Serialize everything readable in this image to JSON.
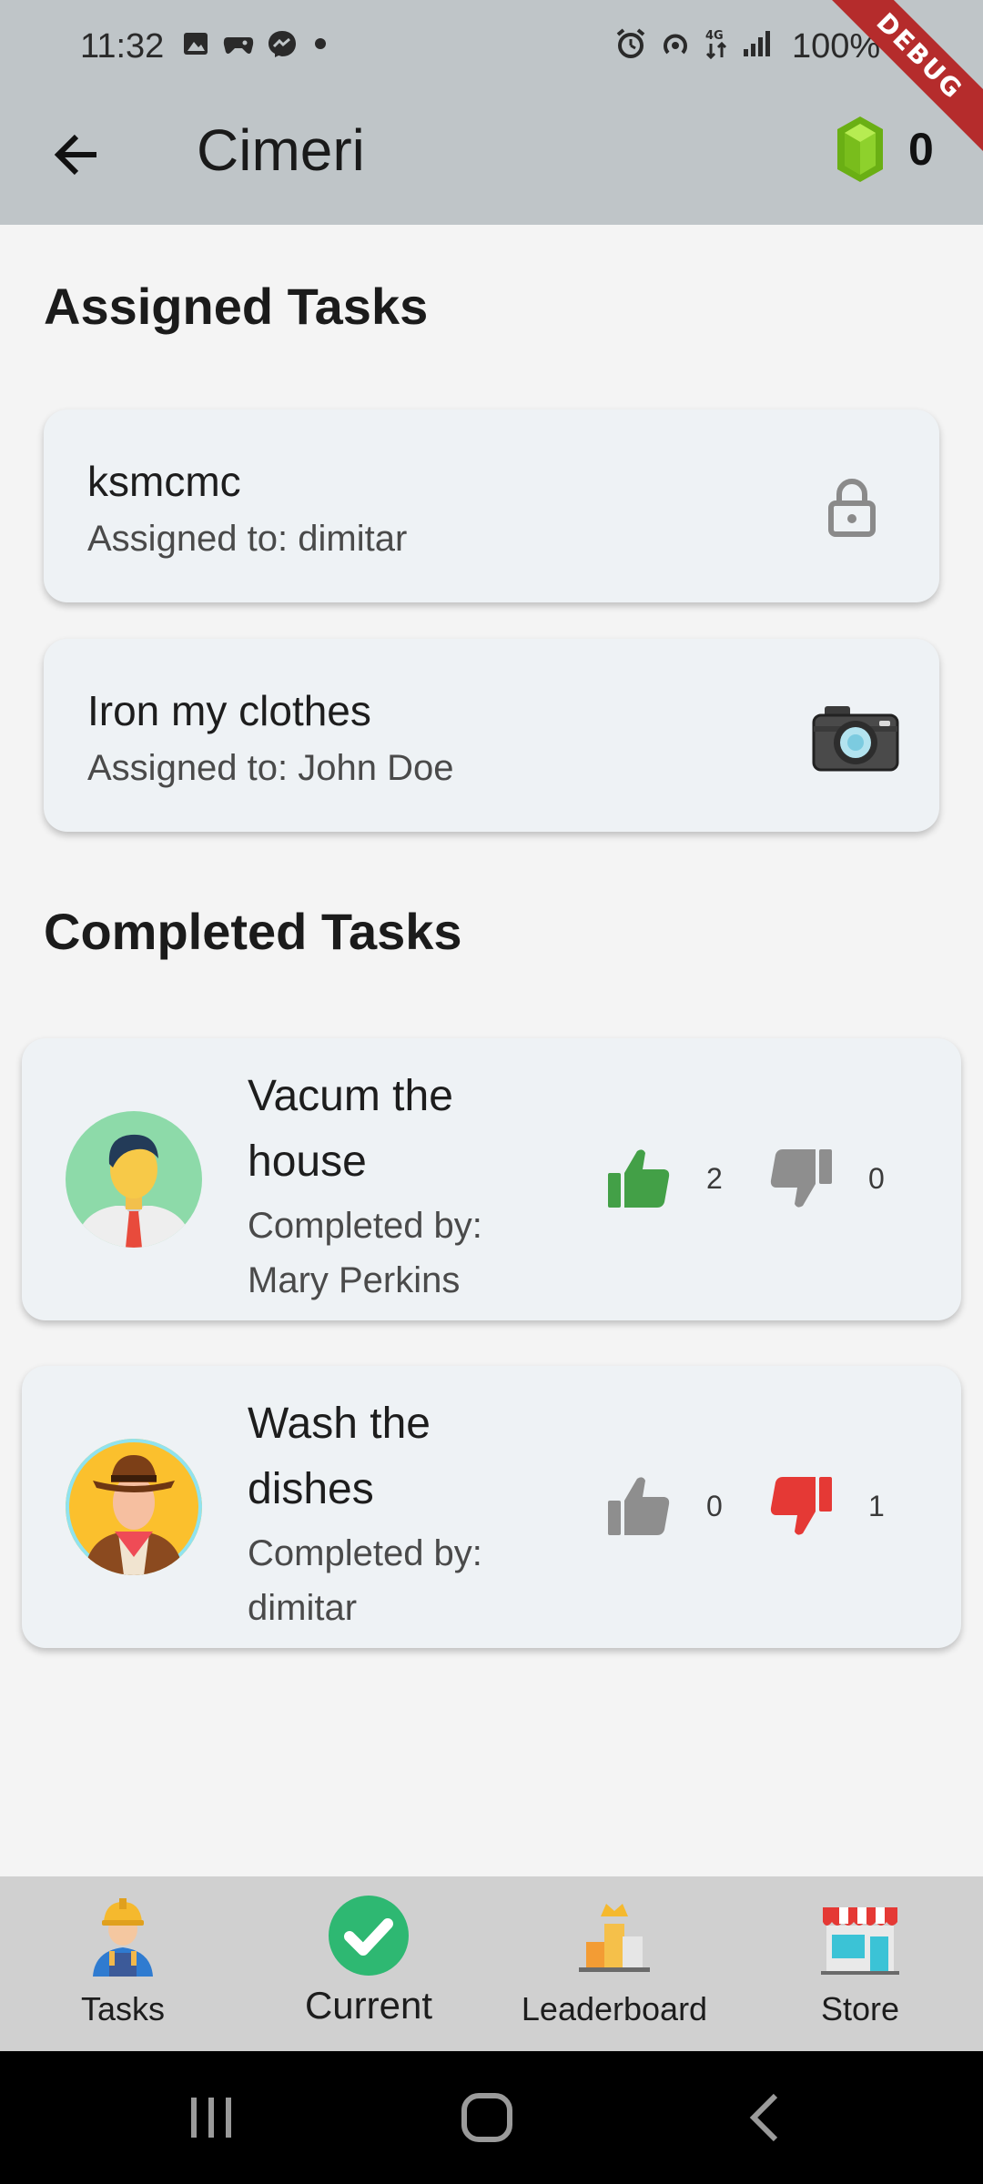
{
  "status_bar": {
    "time": "11:32",
    "battery": "100%",
    "debug_banner": "DEBUG",
    "left_icons": [
      "image-icon",
      "game-icon",
      "messenger-icon",
      "dot-icon"
    ],
    "right_icons": [
      "alarm-icon",
      "hotspot-icon",
      "data-4g-icon",
      "signal-icon"
    ]
  },
  "app_bar": {
    "title": "Cimeri",
    "gem_count": "0"
  },
  "assigned": {
    "title": "Assigned Tasks",
    "tasks": [
      {
        "name": "ksmcmc",
        "assignee": "Assigned to: dimitar",
        "icon": "lock-icon"
      },
      {
        "name": "Iron my clothes",
        "assignee": "Assigned to: John Doe",
        "icon": "camera-icon"
      }
    ]
  },
  "completed": {
    "title": "Completed Tasks",
    "tasks": [
      {
        "title": "Vacum the house",
        "completed_by": "Completed by: Mary Perkins",
        "likes": "2",
        "dislikes": "0",
        "liked": true,
        "disliked": false,
        "avatar": "businessman-avatar"
      },
      {
        "title": "Wash the dishes",
        "completed_by": "Completed by: dimitar",
        "likes": "0",
        "dislikes": "1",
        "liked": false,
        "disliked": true,
        "avatar": "cowboy-avatar"
      }
    ]
  },
  "bottom_nav": {
    "items": [
      {
        "label": "Tasks",
        "icon": "worker-icon",
        "active": false
      },
      {
        "label": "Current",
        "icon": "checkmark-icon",
        "active": true
      },
      {
        "label": "Leaderboard",
        "icon": "leaderboard-icon",
        "active": false
      },
      {
        "label": "Store",
        "icon": "store-icon",
        "active": false
      }
    ]
  },
  "colors": {
    "app_bar": "#bfc5c8",
    "card": "#eef2f5",
    "like_active": "#43a047",
    "dislike_active": "#e53935",
    "vote_inactive": "#8e8e8e",
    "gem": "#7bc21e"
  }
}
